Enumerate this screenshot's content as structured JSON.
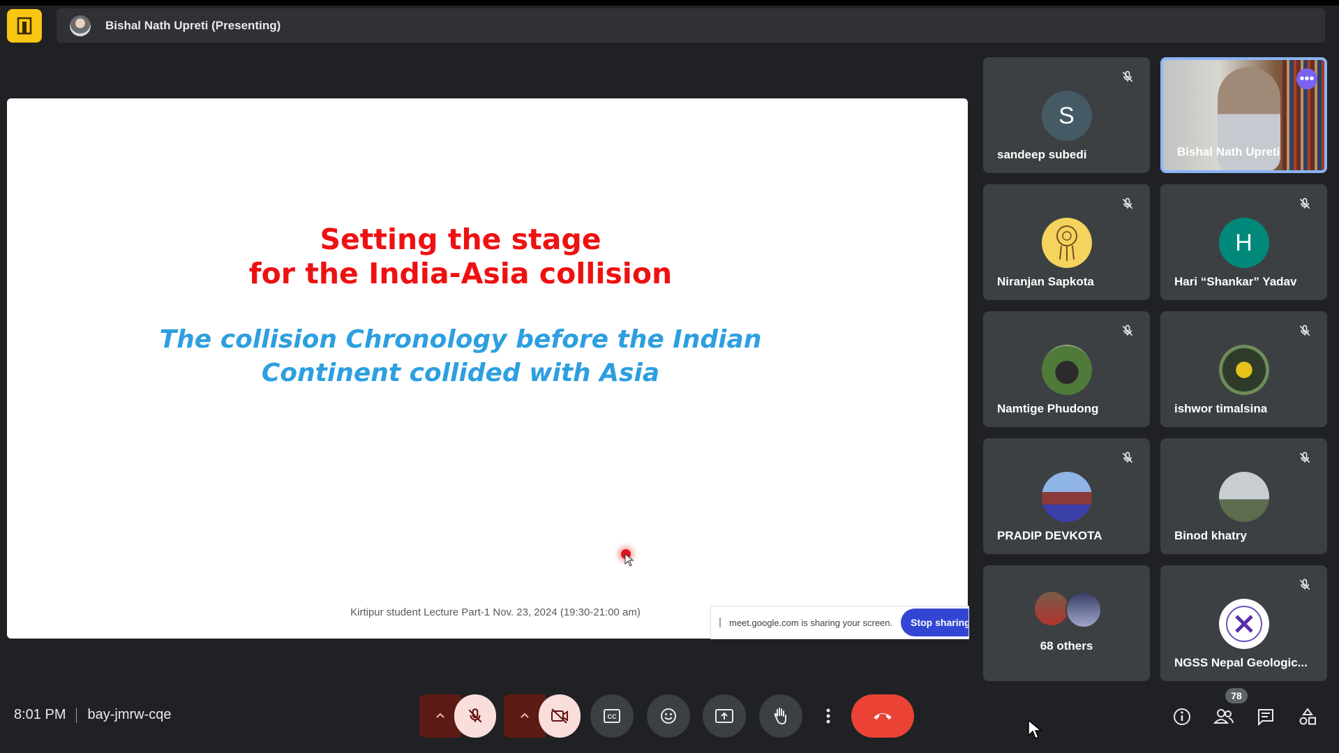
{
  "header": {
    "presenter_label": "Bishal Nath Upreti (Presenting)"
  },
  "slide": {
    "title_line1": "Setting the stage",
    "title_line2": "for the India-Asia collision",
    "subtitle_line1": "The collision Chronology before the Indian",
    "subtitle_line2": "Continent collided with Asia",
    "footer": "Kirtipur student Lecture  Part-1 Nov. 23, 2024 (19:30-21:00 am)"
  },
  "share_notice": {
    "text": "meet.google.com is sharing your screen.",
    "stop_label": "Stop sharing"
  },
  "participants": [
    {
      "name": "sandeep subedi",
      "initial": "S",
      "avatar_color": "#455a64"
    },
    {
      "name": "Bishal Nath Upreti"
    },
    {
      "name": "Niranjan Sapkota"
    },
    {
      "name": "Hari “Shankar” Yadav",
      "initial": "H",
      "avatar_color": "#00897b"
    },
    {
      "name": "Namtige Phudong"
    },
    {
      "name": "ishwor timalsina"
    },
    {
      "name": "PRADIP DEVKOTA"
    },
    {
      "name": "Binod khatry"
    },
    {
      "name": "68 others"
    },
    {
      "name": "NGSS Nepal Geologic..."
    }
  ],
  "footer_bar": {
    "time": "8:01 PM",
    "meeting_code": "bay-jmrw-cqe",
    "people_count": "78"
  },
  "colors": {
    "accent": "#8ab4f8",
    "end_call": "#ea4335",
    "stop_sharing": "#3346d3",
    "slide_title": "#ee1111",
    "slide_subtitle": "#2d9fe0"
  }
}
